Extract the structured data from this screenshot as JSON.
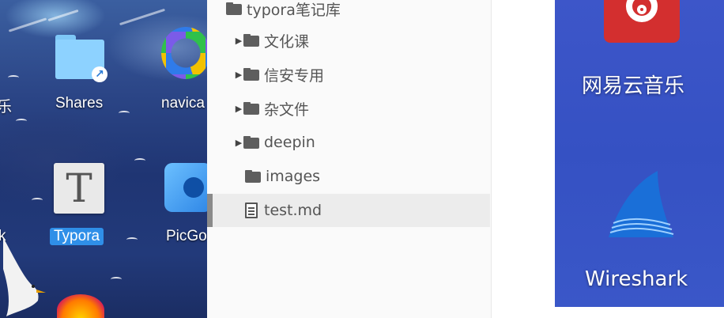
{
  "desktop_left": {
    "partial_label_top": "乐",
    "partial_label_mid": "k",
    "shares_label": "Shares",
    "navicat_label": "navica",
    "typora_label": "Typora",
    "typora_glyph": "T",
    "picgo_label": "PicGo"
  },
  "sidebar": {
    "root_label": "typora笔记库",
    "items": [
      {
        "label": "文化课",
        "type": "folder",
        "expandable": true
      },
      {
        "label": "信安专用",
        "type": "folder",
        "expandable": true
      },
      {
        "label": "杂文件",
        "type": "folder",
        "expandable": true
      },
      {
        "label": "deepin",
        "type": "folder",
        "expandable": true
      },
      {
        "label": "images",
        "type": "folder",
        "expandable": false
      },
      {
        "label": "test.md",
        "type": "file",
        "selected": true
      }
    ]
  },
  "desktop_right": {
    "netease_label": "网易云音乐",
    "wireshark_label": "Wireshark"
  },
  "colors": {
    "right_bg": "#3a55c7",
    "typora_selection": "#2f8fe8",
    "netease_red": "#d32f2f"
  }
}
